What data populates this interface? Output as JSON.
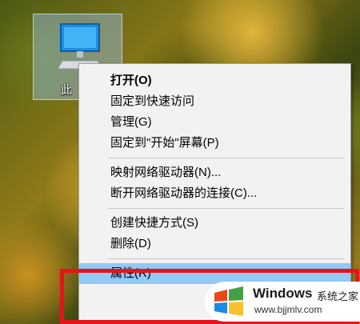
{
  "desktop": {
    "icon": {
      "name": "computer-icon",
      "label": "此"
    }
  },
  "context_menu": {
    "groups": [
      [
        {
          "label": "打开(O)",
          "bold": true
        },
        {
          "label": "固定到快速访问"
        },
        {
          "label": "管理(G)"
        },
        {
          "label": "固定到\"开始\"屏幕(P)"
        }
      ],
      [
        {
          "label": "映射网络驱动器(N)..."
        },
        {
          "label": "断开网络驱动器的连接(C)..."
        }
      ],
      [
        {
          "label": "创建快捷方式(S)"
        },
        {
          "label": "删除(D)"
        }
      ],
      [
        {
          "label": "属性(R)",
          "selected": true
        }
      ]
    ],
    "selected_color": "#91c9f7",
    "highlight_color": "#e5141b"
  },
  "watermark": {
    "brand": "Windows",
    "suffix": "系统之家",
    "url": "www.bjjmlv.com",
    "logo_icon": "windows-logo-icon"
  }
}
